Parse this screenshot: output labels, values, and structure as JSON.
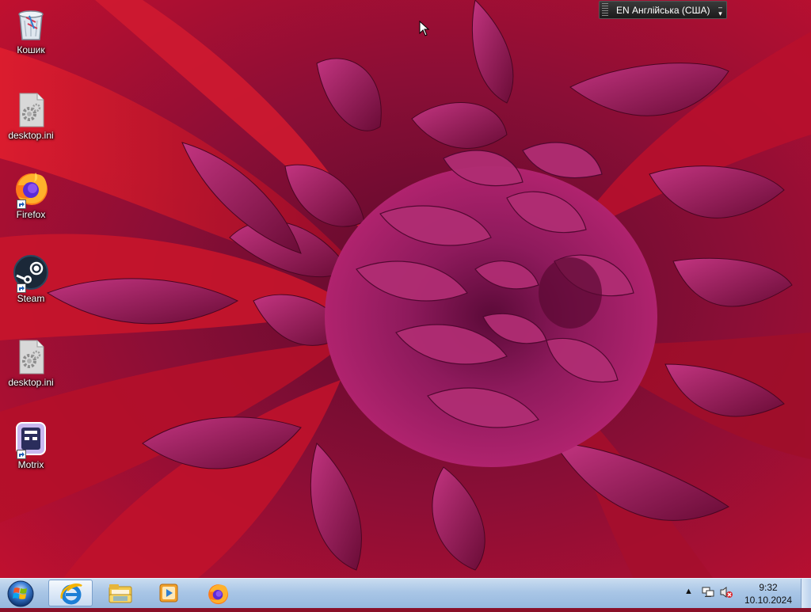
{
  "desktop": {
    "icons": [
      {
        "label": "Кошик",
        "icon": "recycle-bin-icon"
      },
      {
        "label": "desktop.ini",
        "icon": "settings-file-icon"
      },
      {
        "label": "Firefox",
        "icon": "firefox-icon"
      },
      {
        "label": "Steam",
        "icon": "steam-icon"
      },
      {
        "label": "desktop.ini",
        "icon": "settings-file-icon"
      },
      {
        "label": "Motrix",
        "icon": "motrix-icon"
      }
    ]
  },
  "language_bar": {
    "text": "EN Англійська (США)"
  },
  "taskbar": {
    "pinned": [
      {
        "icon": "internet-explorer-icon",
        "active": true
      },
      {
        "icon": "file-explorer-icon",
        "active": false
      },
      {
        "icon": "media-player-icon",
        "active": false
      },
      {
        "icon": "firefox-icon",
        "active": false
      }
    ],
    "tray": {
      "time": "9:32",
      "date": "10.10.2024",
      "icons": [
        "show-hidden-icons-arrow-icon",
        "network-icon",
        "volume-muted-icon"
      ]
    }
  },
  "colors": {
    "wallpaper_base": "#b0102c",
    "petal": "#a3145a",
    "taskbar": "#a9c6e6"
  }
}
